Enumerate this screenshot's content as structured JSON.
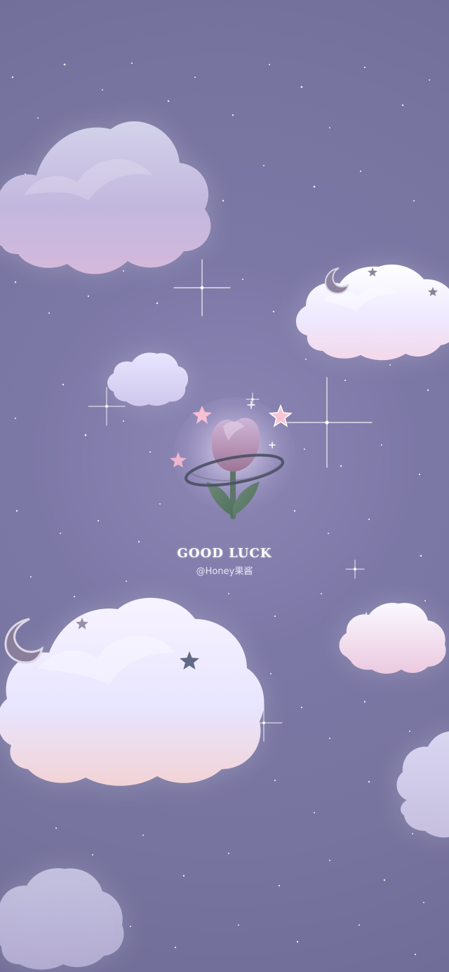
{
  "wallpaper": {
    "message": "GOOD LUCK",
    "credit": "@Honey果酱"
  }
}
